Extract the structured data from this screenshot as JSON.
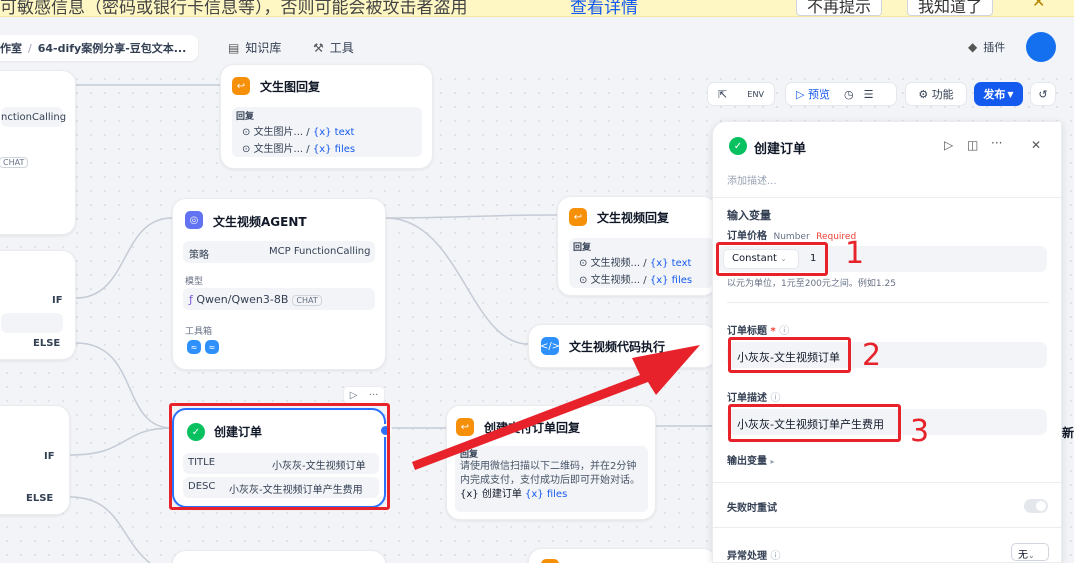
{
  "banner": {
    "text": "可敏感信息（密码或银行卡信息等），否则可能会被攻击者盗用",
    "link": "查看详情",
    "btn_dismiss": "不再提示",
    "btn_ok": "我知道了",
    "close": "✕"
  },
  "header": {
    "breadcrumb_studio": "作室",
    "breadcrumb_app": "64-dify案例分享-豆包文本...",
    "nav_knowledge": "知识库",
    "nav_tools": "工具",
    "plugins": "插件"
  },
  "toolbar": {
    "preview": "预览",
    "features": "功能",
    "publish": "发布"
  },
  "nodes": {
    "left_partial_1": {
      "text": "nctionCalling",
      "chat": "CHAT"
    },
    "if1": {
      "if": "IF",
      "else": "ELSE"
    },
    "if2": {
      "if": "IF",
      "else": "ELSE"
    },
    "img_reply": {
      "title": "文生图回复",
      "reply_label": "回复",
      "row1": "文生图片...",
      "row1_tag": "{x} text",
      "row2": "文生图片...",
      "row2_tag": "{x} files"
    },
    "video_agent": {
      "title": "文生视频AGENT",
      "strategy_label": "策略",
      "strategy_value": "MCP FunctionCalling",
      "model_label": "模型",
      "model_value": "Qwen/Qwen3-8B",
      "model_badge": "CHAT",
      "toolbox_label": "工具箱"
    },
    "video_reply": {
      "title": "文生视频回复",
      "reply_label": "回复",
      "row1": "文生视频...",
      "row1_tag": "{x} text",
      "row2": "文生视频...",
      "row2_tag": "{x} files"
    },
    "video_code": {
      "title": "文生视频代码执行"
    },
    "create_order": {
      "title": "创建订单",
      "title_label": "TITLE",
      "title_value": "小灰灰-文生视频订单",
      "desc_label": "DESC",
      "desc_value": "小灰灰-文生视频订单产生费用"
    },
    "pay_reply": {
      "title": "创建支付订单回复",
      "reply_label": "回复",
      "body": "请使用微信扫描以下二维码，并在2分钟内完成支付，支付成功后即可开始对话。",
      "tag1": "{x} 创建订单",
      "tag2": "{x} files"
    }
  },
  "panel": {
    "title": "创建订单",
    "desc_placeholder": "添加描述...",
    "input_vars": "输入变量",
    "price_label": "订单价格",
    "price_type": "Number",
    "price_required": "Required",
    "price_mode": "Constant",
    "price_value": "1",
    "price_hint": "以元为单位，1元至200元之间。例如1.25",
    "order_title_label": "订单标题",
    "order_title_required": "*",
    "order_title_value": "小灰灰-文生视频订单",
    "order_desc_label": "订单描述",
    "order_desc_value": "小灰灰-文生视频订单产生费用",
    "output_vars": "输出变量",
    "retry": "失败时重试",
    "error_handle": "异常处理",
    "error_value": "无"
  },
  "annotations": {
    "n1": "1",
    "n2": "2",
    "n3": "3"
  },
  "edge_clip": "新"
}
